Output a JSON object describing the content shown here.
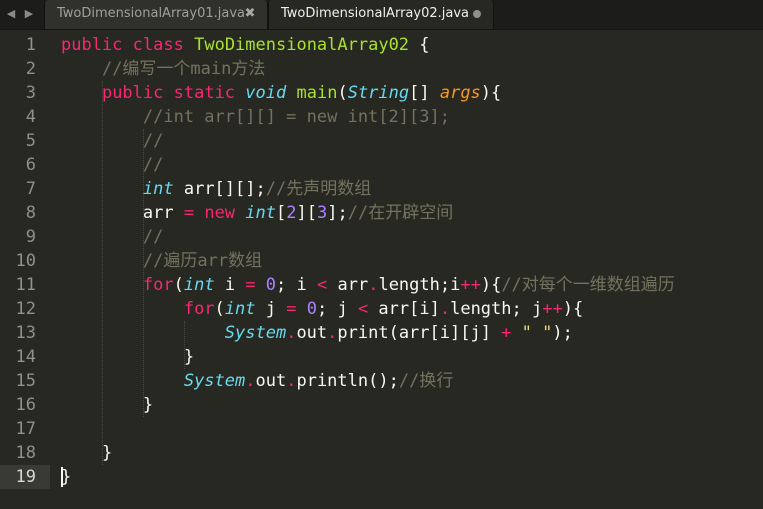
{
  "tabs": [
    {
      "label": "TwoDimensionalArray01.java",
      "active": false,
      "close_icon": "close-icon"
    },
    {
      "label": "TwoDimensionalArray02.java",
      "active": true,
      "dirty_icon": "unsaved-dot-icon"
    }
  ],
  "nav": {
    "left_icon": "triangle-left-icon",
    "right_icon": "triangle-right-icon"
  },
  "theme": {
    "background": "#272822",
    "keyword": "#f92672",
    "type": "#66d9ef",
    "function": "#a6e22e",
    "param": "#fd971f",
    "number": "#ae81ff",
    "string": "#e6db74",
    "comment": "#75715e"
  },
  "editor": {
    "current_line": 19,
    "lines": [
      {
        "number": "1",
        "tokens": [
          {
            "c": "k",
            "t": "public"
          },
          {
            "c": "w",
            "t": " "
          },
          {
            "c": "k",
            "t": "class"
          },
          {
            "c": "w",
            "t": " "
          },
          {
            "c": "cn",
            "t": "TwoDimensionalArray02"
          },
          {
            "c": "w",
            "t": " {"
          }
        ]
      },
      {
        "number": "2",
        "tokens": [
          {
            "c": "w",
            "t": "    "
          },
          {
            "c": "c",
            "t": "//编写一个main方法"
          }
        ]
      },
      {
        "number": "3",
        "tokens": [
          {
            "c": "w",
            "t": "    "
          },
          {
            "c": "k",
            "t": "public"
          },
          {
            "c": "w",
            "t": " "
          },
          {
            "c": "k",
            "t": "static"
          },
          {
            "c": "w",
            "t": " "
          },
          {
            "c": "t",
            "t": "void"
          },
          {
            "c": "w",
            "t": " "
          },
          {
            "c": "fn",
            "t": "main"
          },
          {
            "c": "w",
            "t": "("
          },
          {
            "c": "t",
            "t": "String"
          },
          {
            "c": "w",
            "t": "[] "
          },
          {
            "c": "p",
            "t": "args"
          },
          {
            "c": "w",
            "t": "){"
          }
        ]
      },
      {
        "number": "4",
        "tokens": [
          {
            "c": "w",
            "t": "        "
          },
          {
            "c": "c",
            "t": "//int arr[][] = new int[2][3];"
          }
        ]
      },
      {
        "number": "5",
        "tokens": [
          {
            "c": "w",
            "t": "        "
          },
          {
            "c": "c",
            "t": "//"
          }
        ]
      },
      {
        "number": "6",
        "tokens": [
          {
            "c": "w",
            "t": "        "
          },
          {
            "c": "c",
            "t": "//"
          }
        ]
      },
      {
        "number": "7",
        "tokens": [
          {
            "c": "w",
            "t": "        "
          },
          {
            "c": "t",
            "t": "int"
          },
          {
            "c": "w",
            "t": " arr[][];"
          },
          {
            "c": "c",
            "t": "//先声明数组"
          }
        ]
      },
      {
        "number": "8",
        "tokens": [
          {
            "c": "w",
            "t": "        arr "
          },
          {
            "c": "o",
            "t": "="
          },
          {
            "c": "w",
            "t": " "
          },
          {
            "c": "k",
            "t": "new"
          },
          {
            "c": "w",
            "t": " "
          },
          {
            "c": "t",
            "t": "int"
          },
          {
            "c": "w",
            "t": "["
          },
          {
            "c": "n",
            "t": "2"
          },
          {
            "c": "w",
            "t": "]["
          },
          {
            "c": "n",
            "t": "3"
          },
          {
            "c": "w",
            "t": "];"
          },
          {
            "c": "c",
            "t": "//在开辟空间"
          }
        ]
      },
      {
        "number": "9",
        "tokens": [
          {
            "c": "w",
            "t": "        "
          },
          {
            "c": "c",
            "t": "//"
          }
        ]
      },
      {
        "number": "10",
        "tokens": [
          {
            "c": "w",
            "t": "        "
          },
          {
            "c": "c",
            "t": "//遍历arr数组"
          }
        ]
      },
      {
        "number": "11",
        "tokens": [
          {
            "c": "w",
            "t": "        "
          },
          {
            "c": "k",
            "t": "for"
          },
          {
            "c": "w",
            "t": "("
          },
          {
            "c": "t",
            "t": "int"
          },
          {
            "c": "w",
            "t": " i "
          },
          {
            "c": "o",
            "t": "="
          },
          {
            "c": "w",
            "t": " "
          },
          {
            "c": "n",
            "t": "0"
          },
          {
            "c": "w",
            "t": "; i "
          },
          {
            "c": "o",
            "t": "<"
          },
          {
            "c": "w",
            "t": " arr"
          },
          {
            "c": "o",
            "t": "."
          },
          {
            "c": "w",
            "t": "length;i"
          },
          {
            "c": "o",
            "t": "++"
          },
          {
            "c": "w",
            "t": "){"
          },
          {
            "c": "c",
            "t": "//对每个一维数组遍历"
          }
        ]
      },
      {
        "number": "12",
        "tokens": [
          {
            "c": "w",
            "t": "            "
          },
          {
            "c": "k",
            "t": "for"
          },
          {
            "c": "w",
            "t": "("
          },
          {
            "c": "t",
            "t": "int"
          },
          {
            "c": "w",
            "t": " j "
          },
          {
            "c": "o",
            "t": "="
          },
          {
            "c": "w",
            "t": " "
          },
          {
            "c": "n",
            "t": "0"
          },
          {
            "c": "w",
            "t": "; j "
          },
          {
            "c": "o",
            "t": "<"
          },
          {
            "c": "w",
            "t": " arr[i]"
          },
          {
            "c": "o",
            "t": "."
          },
          {
            "c": "w",
            "t": "length; j"
          },
          {
            "c": "o",
            "t": "++"
          },
          {
            "c": "w",
            "t": "){"
          }
        ]
      },
      {
        "number": "13",
        "tokens": [
          {
            "c": "w",
            "t": "                "
          },
          {
            "c": "t",
            "t": "System"
          },
          {
            "c": "o",
            "t": "."
          },
          {
            "c": "w",
            "t": "out"
          },
          {
            "c": "o",
            "t": "."
          },
          {
            "c": "w",
            "t": "print(arr[i][j] "
          },
          {
            "c": "o",
            "t": "+"
          },
          {
            "c": "w",
            "t": " "
          },
          {
            "c": "s",
            "t": "\" \""
          },
          {
            "c": "w",
            "t": ");"
          }
        ]
      },
      {
        "number": "14",
        "tokens": [
          {
            "c": "w",
            "t": "            }"
          }
        ]
      },
      {
        "number": "15",
        "tokens": [
          {
            "c": "w",
            "t": "            "
          },
          {
            "c": "t",
            "t": "System"
          },
          {
            "c": "o",
            "t": "."
          },
          {
            "c": "w",
            "t": "out"
          },
          {
            "c": "o",
            "t": "."
          },
          {
            "c": "w",
            "t": "println();"
          },
          {
            "c": "c",
            "t": "//换行"
          }
        ]
      },
      {
        "number": "16",
        "tokens": [
          {
            "c": "w",
            "t": "        }"
          }
        ]
      },
      {
        "number": "17",
        "tokens": []
      },
      {
        "number": "18",
        "tokens": [
          {
            "c": "w",
            "t": "    }"
          }
        ]
      },
      {
        "number": "19",
        "tokens": [
          {
            "c": "w",
            "t": "}"
          }
        ]
      }
    ]
  }
}
